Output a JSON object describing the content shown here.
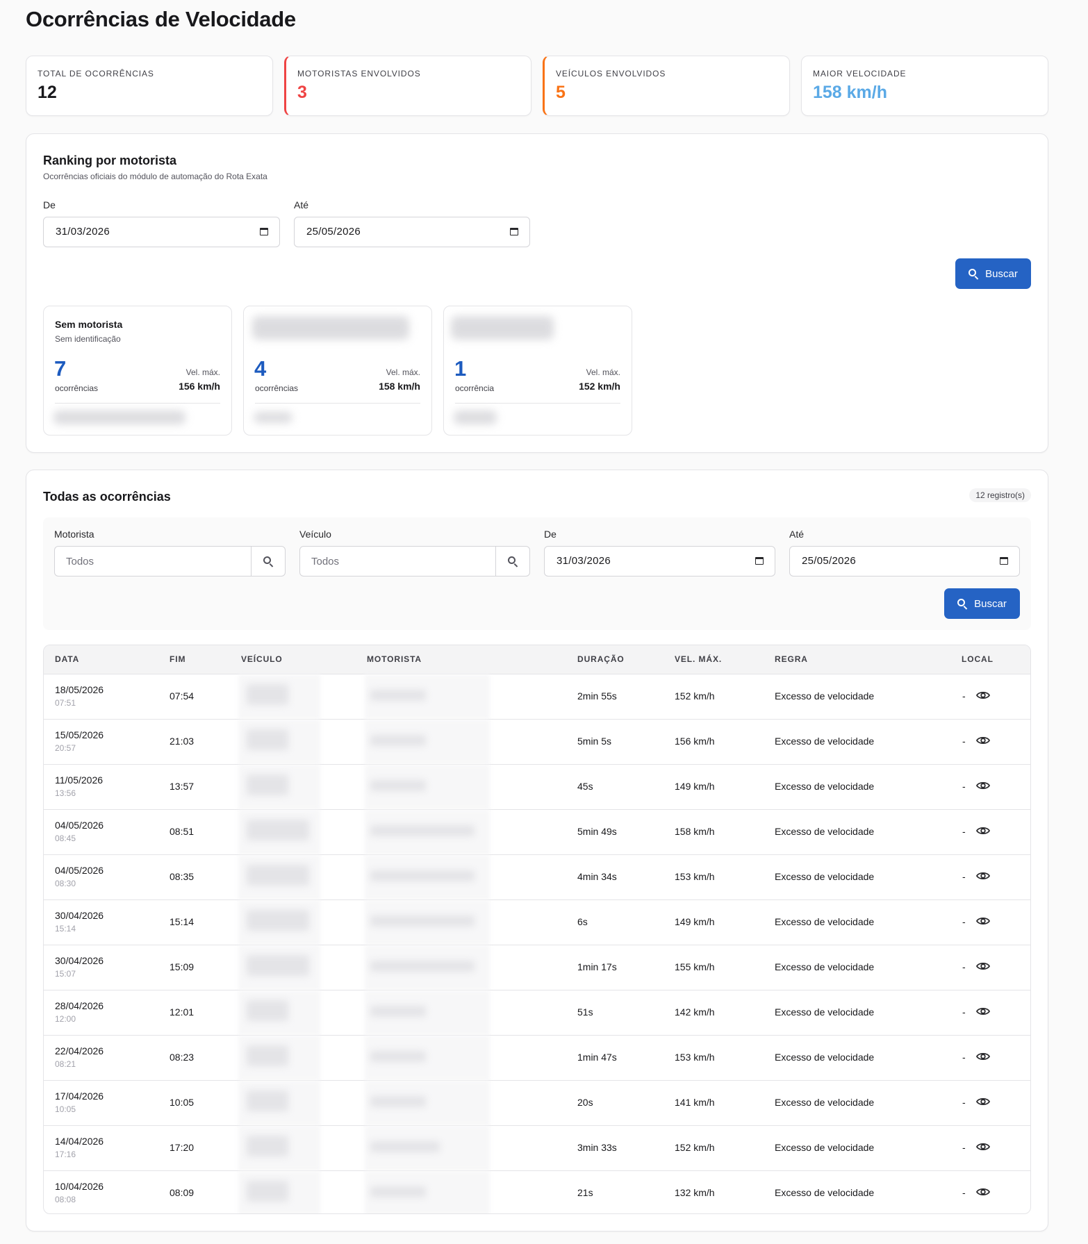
{
  "page": {
    "title": "Ocorrências de Velocidade"
  },
  "kpis": [
    {
      "label": "TOTAL DE OCORRÊNCIAS",
      "value": "12",
      "color": "#18181b"
    },
    {
      "label": "MOTORISTAS ENVOLVIDOS",
      "value": "3",
      "color": "#ef4444"
    },
    {
      "label": "VEÍCULOS ENVOLVIDOS",
      "value": "5",
      "color": "#f97316"
    },
    {
      "label": "MAIOR VELOCIDADE",
      "value": "158 km/h",
      "color": "#5aa9e6"
    }
  ],
  "ranking": {
    "title": "Ranking por motorista",
    "subtitle": "Ocorrências oficiais do módulo de automação do Rota Exata",
    "from_label": "De",
    "from_value": "31/03/2026",
    "to_label": "Até",
    "to_value": "25/05/2026",
    "search_label": "Buscar",
    "cards": [
      {
        "name": "Sem motorista",
        "id": "Sem identificação",
        "count": "7",
        "count_label": "ocorrências",
        "vel_label": "Vel. máx.",
        "vel": "156 km/h"
      },
      {
        "name": "",
        "id": "",
        "count": "4",
        "count_label": "ocorrências",
        "vel_label": "Vel. máx.",
        "vel": "158 km/h"
      },
      {
        "name": "",
        "id": "",
        "count": "1",
        "count_label": "ocorrência",
        "vel_label": "Vel. máx.",
        "vel": "152 km/h"
      }
    ]
  },
  "occurrences": {
    "title": "Todas as ocorrências",
    "badge": "12 registro(s)",
    "filters": {
      "driver_label": "Motorista",
      "driver_placeholder": "Todos",
      "vehicle_label": "Veículo",
      "vehicle_placeholder": "Todos",
      "from_label": "De",
      "from_value": "31/03/2026",
      "to_label": "Até",
      "to_value": "25/05/2026",
      "search_label": "Buscar"
    },
    "columns": [
      "DATA",
      "FIM",
      "VEÍCULO",
      "MOTORISTA",
      "DURAÇÃO",
      "VEL. MÁX.",
      "REGRA",
      "LOCAL"
    ],
    "rows": [
      {
        "date": "18/05/2026",
        "start": "07:51",
        "end": "07:54",
        "duration": "2min 55s",
        "speed": "152 km/h",
        "rule": "Excesso de velocidade",
        "local": "-"
      },
      {
        "date": "15/05/2026",
        "start": "20:57",
        "end": "21:03",
        "duration": "5min 5s",
        "speed": "156 km/h",
        "rule": "Excesso de velocidade",
        "local": "-"
      },
      {
        "date": "11/05/2026",
        "start": "13:56",
        "end": "13:57",
        "duration": "45s",
        "speed": "149 km/h",
        "rule": "Excesso de velocidade",
        "local": "-"
      },
      {
        "date": "04/05/2026",
        "start": "08:45",
        "end": "08:51",
        "duration": "5min 49s",
        "speed": "158 km/h",
        "rule": "Excesso de velocidade",
        "local": "-"
      },
      {
        "date": "04/05/2026",
        "start": "08:30",
        "end": "08:35",
        "duration": "4min 34s",
        "speed": "153 km/h",
        "rule": "Excesso de velocidade",
        "local": "-"
      },
      {
        "date": "30/04/2026",
        "start": "15:14",
        "end": "15:14",
        "duration": "6s",
        "speed": "149 km/h",
        "rule": "Excesso de velocidade",
        "local": "-"
      },
      {
        "date": "30/04/2026",
        "start": "15:07",
        "end": "15:09",
        "duration": "1min 17s",
        "speed": "155 km/h",
        "rule": "Excesso de velocidade",
        "local": "-"
      },
      {
        "date": "28/04/2026",
        "start": "12:00",
        "end": "12:01",
        "duration": "51s",
        "speed": "142 km/h",
        "rule": "Excesso de velocidade",
        "local": "-"
      },
      {
        "date": "22/04/2026",
        "start": "08:21",
        "end": "08:23",
        "duration": "1min 47s",
        "speed": "153 km/h",
        "rule": "Excesso de velocidade",
        "local": "-"
      },
      {
        "date": "17/04/2026",
        "start": "10:05",
        "end": "10:05",
        "duration": "20s",
        "speed": "141 km/h",
        "rule": "Excesso de velocidade",
        "local": "-"
      },
      {
        "date": "14/04/2026",
        "start": "17:16",
        "end": "17:20",
        "duration": "3min 33s",
        "speed": "152 km/h",
        "rule": "Excesso de velocidade",
        "local": "-"
      },
      {
        "date": "10/04/2026",
        "start": "08:08",
        "end": "08:09",
        "duration": "21s",
        "speed": "132 km/h",
        "rule": "Excesso de velocidade",
        "local": "-"
      }
    ]
  },
  "icons": {
    "search": "search-icon",
    "calendar": "calendar-icon",
    "view": "eye-icon"
  }
}
